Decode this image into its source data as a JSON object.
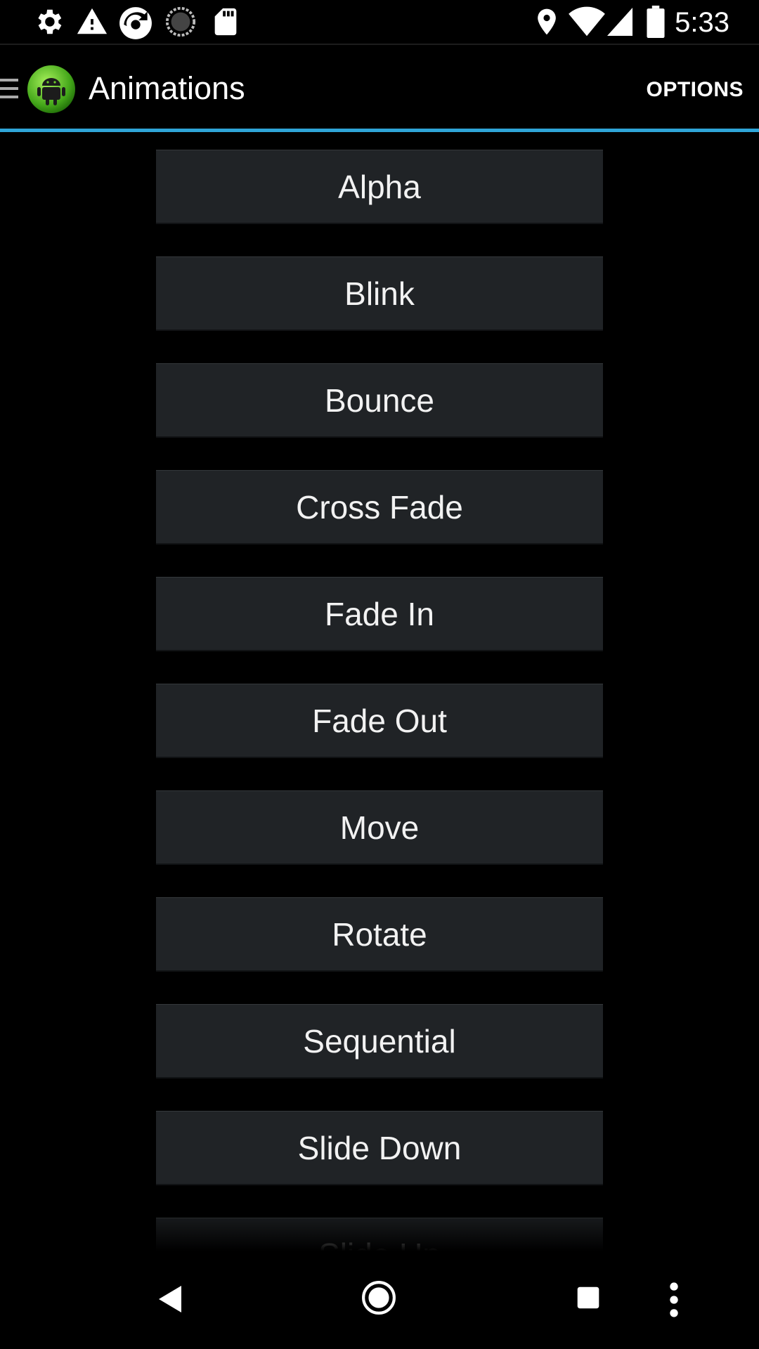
{
  "status_bar": {
    "time": "5:33",
    "left_icons": [
      "gear-icon",
      "warning-icon",
      "sync-app-icon",
      "loading-circle-icon",
      "sd-card-icon"
    ],
    "right_icons": [
      "location-pin-icon",
      "wifi-icon",
      "cell-signal-icon",
      "battery-icon"
    ]
  },
  "app_bar": {
    "title": "Animations",
    "options_label": "OPTIONS",
    "accent_color": "#2fa5d8"
  },
  "animations": [
    "Alpha",
    "Blink",
    "Bounce",
    "Cross Fade",
    "Fade In",
    "Fade Out",
    "Move",
    "Rotate",
    "Sequential",
    "Slide Down",
    "Slide Up"
  ],
  "nav_bar": {
    "icons": [
      "back-icon",
      "home-icon",
      "recents-icon",
      "overflow-menu-icon"
    ]
  }
}
